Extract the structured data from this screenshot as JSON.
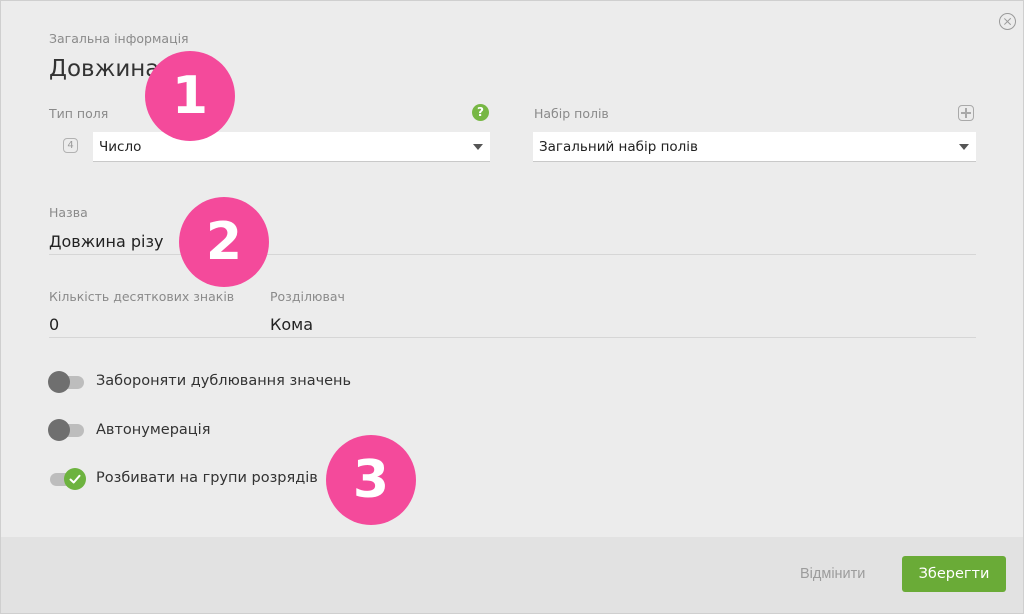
{
  "header": {
    "section_label": "Загальна інформація",
    "title": "Довжина різу"
  },
  "field_type": {
    "label": "Тип поля",
    "code": "4",
    "value": "Число"
  },
  "field_set": {
    "label": "Набір полів",
    "value": "Загальний набір полів"
  },
  "name": {
    "label": "Назва",
    "value": "Довжина різу"
  },
  "decimals": {
    "label": "Кількість десяткових знаків",
    "value": "0"
  },
  "separator": {
    "label": "Розділювач",
    "value": "Кома"
  },
  "toggles": [
    {
      "label": "Забороняти дублювання значень",
      "on": false
    },
    {
      "label": "Автонумерація",
      "on": false
    },
    {
      "label": "Розбивати на групи розрядів",
      "on": true
    }
  ],
  "callouts": [
    "1",
    "2",
    "3"
  ],
  "footer": {
    "cancel_label": "Відмінити",
    "save_label": "Зберегти"
  },
  "colors": {
    "accent_green": "#6aab37",
    "callout_pink": "#f44a9b",
    "background": "#ececec"
  },
  "icons": {
    "help": "help-icon",
    "add": "plus-icon",
    "close": "close-icon"
  }
}
